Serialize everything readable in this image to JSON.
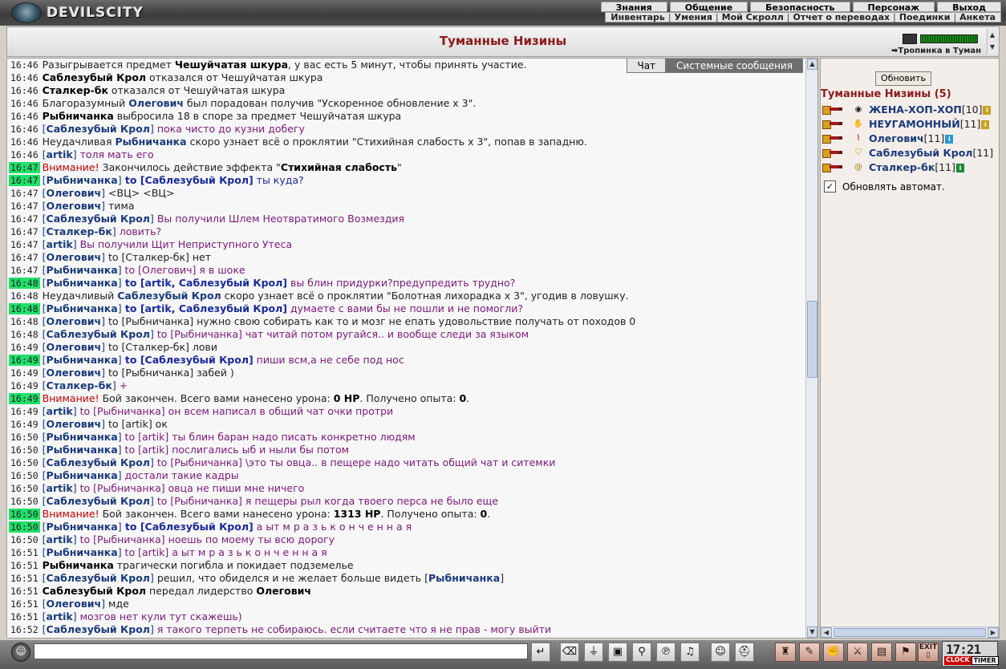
{
  "app": {
    "logo_text": "DEVILSCITY"
  },
  "menu_top": [
    "Знания",
    "Общение",
    "Безопасность",
    "Персонаж",
    "Выход"
  ],
  "menu_sub": [
    "Инвентарь",
    "Умения",
    "Мой Скролл",
    "Отчет о переводах",
    "Поединки",
    "Анкета"
  ],
  "location": {
    "title": "Туманные Низины",
    "path_label": "Тропинка в Туман"
  },
  "chat_tabs": {
    "chat": "Чат",
    "system": "Системные сообщения"
  },
  "chat_lines": [
    {
      "time": "16:46",
      "hl": false,
      "parts": [
        [
          "msg",
          "Разыгрывается предмет "
        ],
        [
          "b",
          "Чешуйчатая шкура"
        ],
        [
          "msg",
          ", у вас есть 5 минут, чтобы принять участие."
        ]
      ]
    },
    {
      "time": "16:46",
      "hl": false,
      "parts": [
        [
          "b",
          "Саблезубый Крол"
        ],
        [
          "msg",
          " отказался от Чешуйчатая шкура"
        ]
      ]
    },
    {
      "time": "16:46",
      "hl": false,
      "parts": [
        [
          "b",
          "Сталкер-бк"
        ],
        [
          "msg",
          " отказался от Чешуйчатая шкура"
        ]
      ]
    },
    {
      "time": "16:46",
      "hl": false,
      "parts": [
        [
          "msg",
          "Благоразумный "
        ],
        [
          "nm",
          "Олегович"
        ],
        [
          "msg",
          " был порадован получив \"Ускоренное обновление х 3\"."
        ]
      ]
    },
    {
      "time": "16:46",
      "hl": false,
      "parts": [
        [
          "b",
          "Рыбничанка"
        ],
        [
          "msg",
          " выбросила 18 в споре за предмет Чешуйчатая шкура"
        ]
      ]
    },
    {
      "time": "16:46",
      "hl": false,
      "parts": [
        [
          "br",
          "["
        ],
        [
          "nm",
          "Саблезубый Крол"
        ],
        [
          "br",
          "]"
        ],
        [
          "purple",
          " пока чисто до кузни добегу"
        ]
      ]
    },
    {
      "time": "16:46",
      "hl": false,
      "parts": [
        [
          "msg",
          "Неудачливая "
        ],
        [
          "nm",
          "Рыбничанка"
        ],
        [
          "msg",
          " скоро узнает всё о проклятии \"Стихийная слабость х 3\", попав в западню."
        ]
      ]
    },
    {
      "time": "16:46",
      "hl": false,
      "parts": [
        [
          "br",
          "["
        ],
        [
          "nm",
          "artik"
        ],
        [
          "br",
          "]"
        ],
        [
          "purple",
          " толя мать его"
        ]
      ]
    },
    {
      "time": "16:47",
      "hl": true,
      "parts": [
        [
          "warn",
          "Внимание!"
        ],
        [
          "msg",
          " Закончилось действие эффекта \""
        ],
        [
          "b",
          "Стихийная слабость"
        ],
        [
          "msg",
          "\""
        ]
      ]
    },
    {
      "time": "16:47",
      "hl": true,
      "parts": [
        [
          "br",
          "["
        ],
        [
          "nm",
          "Рыбничанка"
        ],
        [
          "br",
          "]"
        ],
        [
          "boldblue",
          " to [Саблезубый Крол]"
        ],
        [
          "blue",
          " ты куда?"
        ]
      ]
    },
    {
      "time": "16:47",
      "hl": false,
      "parts": [
        [
          "br",
          "["
        ],
        [
          "nm",
          "Олегович"
        ],
        [
          "br",
          "]"
        ],
        [
          "msg",
          " <ВЦ> <ВЦ>"
        ]
      ]
    },
    {
      "time": "16:47",
      "hl": false,
      "parts": [
        [
          "br",
          "["
        ],
        [
          "nm",
          "Олегович"
        ],
        [
          "br",
          "]"
        ],
        [
          "msg",
          " тима"
        ]
      ]
    },
    {
      "time": "16:47",
      "hl": false,
      "parts": [
        [
          "br",
          "["
        ],
        [
          "nm",
          "Саблезубый Крол"
        ],
        [
          "br",
          "]"
        ],
        [
          "purple",
          " Вы получили Шлем Неотвратимого Возмездия"
        ]
      ]
    },
    {
      "time": "16:47",
      "hl": false,
      "parts": [
        [
          "br",
          "["
        ],
        [
          "nm",
          "Сталкер-бк"
        ],
        [
          "br",
          "]"
        ],
        [
          "purple",
          " ловить?"
        ]
      ]
    },
    {
      "time": "16:47",
      "hl": false,
      "parts": [
        [
          "br",
          "["
        ],
        [
          "nm",
          "artik"
        ],
        [
          "br",
          "]"
        ],
        [
          "purple",
          " Вы получили Щит Неприступного Утеса"
        ]
      ]
    },
    {
      "time": "16:47",
      "hl": false,
      "parts": [
        [
          "br",
          "["
        ],
        [
          "nm",
          "Олегович"
        ],
        [
          "br",
          "]"
        ],
        [
          "msg",
          " to [Сталкер-бк] нет"
        ]
      ]
    },
    {
      "time": "16:47",
      "hl": false,
      "parts": [
        [
          "br",
          "["
        ],
        [
          "nm",
          "Рыбничанка"
        ],
        [
          "br",
          "]"
        ],
        [
          "purple",
          " to [Олегович] я в шоке"
        ]
      ]
    },
    {
      "time": "16:48",
      "hl": true,
      "parts": [
        [
          "br",
          "["
        ],
        [
          "nm",
          "Рыбничанка"
        ],
        [
          "br",
          "]"
        ],
        [
          "boldblue",
          " to [artik, Саблезубый Крол]"
        ],
        [
          "purple",
          " вы блин придурки?предупредить трудно?"
        ]
      ]
    },
    {
      "time": "16:48",
      "hl": false,
      "parts": [
        [
          "msg",
          "Неудачливый "
        ],
        [
          "nm",
          "Саблезубый Крол"
        ],
        [
          "msg",
          " скоро узнает всё о проклятии \"Болотная лихорадка х 3\", угодив в ловушку."
        ]
      ]
    },
    {
      "time": "16:48",
      "hl": true,
      "parts": [
        [
          "br",
          "["
        ],
        [
          "nm",
          "Рыбничанка"
        ],
        [
          "br",
          "]"
        ],
        [
          "boldblue",
          " to [artik, Саблезубый Крол]"
        ],
        [
          "purple",
          " думаете с вами бы не пошли и не помогли?"
        ]
      ]
    },
    {
      "time": "16:48",
      "hl": false,
      "parts": [
        [
          "br",
          "["
        ],
        [
          "nm",
          "Олегович"
        ],
        [
          "br",
          "]"
        ],
        [
          "msg",
          " to [Рыбничанка] нужно свою собирать как то и мозг не епать удовольствие получать от походов 0"
        ]
      ]
    },
    {
      "time": "16:48",
      "hl": false,
      "parts": [
        [
          "br",
          "["
        ],
        [
          "nm",
          "Саблезубый Крол"
        ],
        [
          "br",
          "]"
        ],
        [
          "purple",
          " to [Рыбничанка] чат читай потом ругайся.. и вообще следи за языком"
        ]
      ]
    },
    {
      "time": "16:49",
      "hl": false,
      "parts": [
        [
          "br",
          "["
        ],
        [
          "nm",
          "Олегович"
        ],
        [
          "br",
          "]"
        ],
        [
          "msg",
          " to [Сталкер-бк] лови"
        ]
      ]
    },
    {
      "time": "16:49",
      "hl": true,
      "parts": [
        [
          "br",
          "["
        ],
        [
          "nm",
          "Рыбничанка"
        ],
        [
          "br",
          "]"
        ],
        [
          "boldblue",
          " to [Саблезубый Крол]"
        ],
        [
          "purple",
          " пиши всм,а не себе под нос"
        ]
      ]
    },
    {
      "time": "16:49",
      "hl": false,
      "parts": [
        [
          "br",
          "["
        ],
        [
          "nm",
          "Олегович"
        ],
        [
          "br",
          "]"
        ],
        [
          "msg",
          " to [Рыбничанка] забей )"
        ]
      ]
    },
    {
      "time": "16:49",
      "hl": false,
      "parts": [
        [
          "br",
          "["
        ],
        [
          "nm",
          "Сталкер-бк"
        ],
        [
          "br",
          "]"
        ],
        [
          "purple",
          " +"
        ]
      ]
    },
    {
      "time": "16:49",
      "hl": true,
      "parts": [
        [
          "warn",
          "Внимание!"
        ],
        [
          "msg",
          " Бой закончен. Всего вами нанесено урона: "
        ],
        [
          "b",
          "0 HP"
        ],
        [
          "msg",
          ". Получено опыта: "
        ],
        [
          "b",
          "0"
        ],
        [
          "msg",
          "."
        ]
      ]
    },
    {
      "time": "16:49",
      "hl": false,
      "parts": [
        [
          "br",
          "["
        ],
        [
          "nm",
          "artik"
        ],
        [
          "br",
          "]"
        ],
        [
          "purple",
          " to [Рыбничанка] он всем написал в общий чат очки протри"
        ]
      ]
    },
    {
      "time": "16:49",
      "hl": false,
      "parts": [
        [
          "br",
          "["
        ],
        [
          "nm",
          "Олегович"
        ],
        [
          "br",
          "]"
        ],
        [
          "msg",
          " to [artik] ок"
        ]
      ]
    },
    {
      "time": "16:50",
      "hl": false,
      "parts": [
        [
          "br",
          "["
        ],
        [
          "nm",
          "Рыбничанка"
        ],
        [
          "br",
          "]"
        ],
        [
          "purple",
          " to [artik] ты блин баран надо писать конкретно людям"
        ]
      ]
    },
    {
      "time": "16:50",
      "hl": false,
      "parts": [
        [
          "br",
          "["
        ],
        [
          "nm",
          "Рыбничанка"
        ],
        [
          "br",
          "]"
        ],
        [
          "purple",
          " to [artik] послигались ыб и ныли бы потом"
        ]
      ]
    },
    {
      "time": "16:50",
      "hl": false,
      "parts": [
        [
          "br",
          "["
        ],
        [
          "nm",
          "Саблезубый Крол"
        ],
        [
          "br",
          "]"
        ],
        [
          "purple",
          " to [Рыбничанка] \\это ты овца.. в пещере надо читать общий чат и ситемки"
        ]
      ]
    },
    {
      "time": "16:50",
      "hl": false,
      "parts": [
        [
          "br",
          "["
        ],
        [
          "nm",
          "Рыбничанка"
        ],
        [
          "br",
          "]"
        ],
        [
          "purple",
          " достали такие кадры"
        ]
      ]
    },
    {
      "time": "16:50",
      "hl": false,
      "parts": [
        [
          "br",
          "["
        ],
        [
          "nm",
          "artik"
        ],
        [
          "br",
          "]"
        ],
        [
          "purple",
          " to [Рыбничанка] овца не пиши мне ничего"
        ]
      ]
    },
    {
      "time": "16:50",
      "hl": false,
      "parts": [
        [
          "br",
          "["
        ],
        [
          "nm",
          "Саблезубый Крол"
        ],
        [
          "br",
          "]"
        ],
        [
          "purple",
          " to [Рыбничанка] я пещеры рыл когда твоего перса не было еще"
        ]
      ]
    },
    {
      "time": "16:50",
      "hl": true,
      "parts": [
        [
          "warn",
          "Внимание!"
        ],
        [
          "msg",
          " Бой закончен. Всего вами нанесено урона: "
        ],
        [
          "b",
          "1313 HP"
        ],
        [
          "msg",
          ". Получено опыта: "
        ],
        [
          "b",
          "0"
        ],
        [
          "msg",
          "."
        ]
      ]
    },
    {
      "time": "16:50",
      "hl": true,
      "parts": [
        [
          "br",
          "["
        ],
        [
          "nm",
          "Рыбничанка"
        ],
        [
          "br",
          "]"
        ],
        [
          "boldblue",
          " to [Саблезубый Крол]"
        ],
        [
          "purple",
          " а ыт м р а з ь к о н ч е н н а я"
        ]
      ]
    },
    {
      "time": "16:50",
      "hl": false,
      "parts": [
        [
          "br",
          "["
        ],
        [
          "nm",
          "artik"
        ],
        [
          "br",
          "]"
        ],
        [
          "purple",
          " to [Рыбничанка] ноешь по моему ты всю дорогу"
        ]
      ]
    },
    {
      "time": "16:51",
      "hl": false,
      "parts": [
        [
          "br",
          "["
        ],
        [
          "nm",
          "Рыбничанка"
        ],
        [
          "br",
          "]"
        ],
        [
          "purple",
          " to [artik] а ыт м р а з ь к о н ч е н н а я"
        ]
      ]
    },
    {
      "time": "16:51",
      "hl": false,
      "parts": [
        [
          "b",
          "Рыбничанка"
        ],
        [
          "msg",
          " трагически погибла и покидает подземелье"
        ]
      ]
    },
    {
      "time": "16:51",
      "hl": false,
      "parts": [
        [
          "br",
          "["
        ],
        [
          "nm",
          "Саблезубый Крол"
        ],
        [
          "br",
          "]"
        ],
        [
          "msg",
          " решил, что обиделся и не желает больше видеть ["
        ],
        [
          "nm",
          "Рыбничанка"
        ],
        [
          "msg",
          "]"
        ]
      ]
    },
    {
      "time": "16:51",
      "hl": false,
      "parts": [
        [
          "b",
          "Саблезубый Крол"
        ],
        [
          "msg",
          " передал лидерство "
        ],
        [
          "b",
          "Олегович"
        ]
      ]
    },
    {
      "time": "16:51",
      "hl": false,
      "parts": [
        [
          "br",
          "["
        ],
        [
          "nm",
          "Олегович"
        ],
        [
          "br",
          "]"
        ],
        [
          "msg",
          " мде"
        ]
      ]
    },
    {
      "time": "16:51",
      "hl": false,
      "parts": [
        [
          "br",
          "["
        ],
        [
          "nm",
          "artik"
        ],
        [
          "br",
          "]"
        ],
        [
          "purple",
          " мозгов нет кули тут скажешь)"
        ]
      ]
    },
    {
      "time": "16:52",
      "hl": false,
      "parts": [
        [
          "br",
          "["
        ],
        [
          "nm",
          "Саблезубый Крол"
        ],
        [
          "br",
          "]"
        ],
        [
          "purple",
          " я такого терпеть не собираюсь. если считаете что я не прав - могу выйти"
        ]
      ]
    }
  ],
  "side": {
    "refresh_label": "Обновить",
    "title": "Туманные Низины (5)",
    "users": [
      {
        "name": "ЖЕНА-ХОП-ХОП",
        "level": "[10]",
        "clan_icon": "globe-icon",
        "clan_glyph": "◉",
        "clan_color": "#222222",
        "info_color": "#c8a020"
      },
      {
        "name": "НЕУГАМОННЫЙ",
        "level": "[11]",
        "clan_icon": "hand-icon",
        "clan_glyph": "✋",
        "clan_color": "#8a1a1a",
        "info_color": "#c8a020"
      },
      {
        "name": "Олегович",
        "level": "[11]",
        "clan_icon": "pulse-icon",
        "clan_glyph": "⌇",
        "clan_color": "#c01010",
        "info_color": "#2a9ad0"
      },
      {
        "name": "Саблезубый Крол",
        "level": "[11]",
        "clan_icon": "shield-icon",
        "clan_glyph": "⛉",
        "clan_color": "#c8a010",
        "info_color": ""
      },
      {
        "name": "Сталкер-бк",
        "level": "[11]",
        "clan_icon": "spiral-icon",
        "clan_glyph": "@",
        "clan_color": "#a08010",
        "info_color": "#1a8a3a"
      }
    ],
    "auto_label": "Обновлять автомат."
  },
  "bottom": {
    "input_value": "",
    "exit_label": "EXIT",
    "clock_time": "17:21",
    "clock_label_1": "CLOCK",
    "clock_label_2": "TIMER"
  }
}
